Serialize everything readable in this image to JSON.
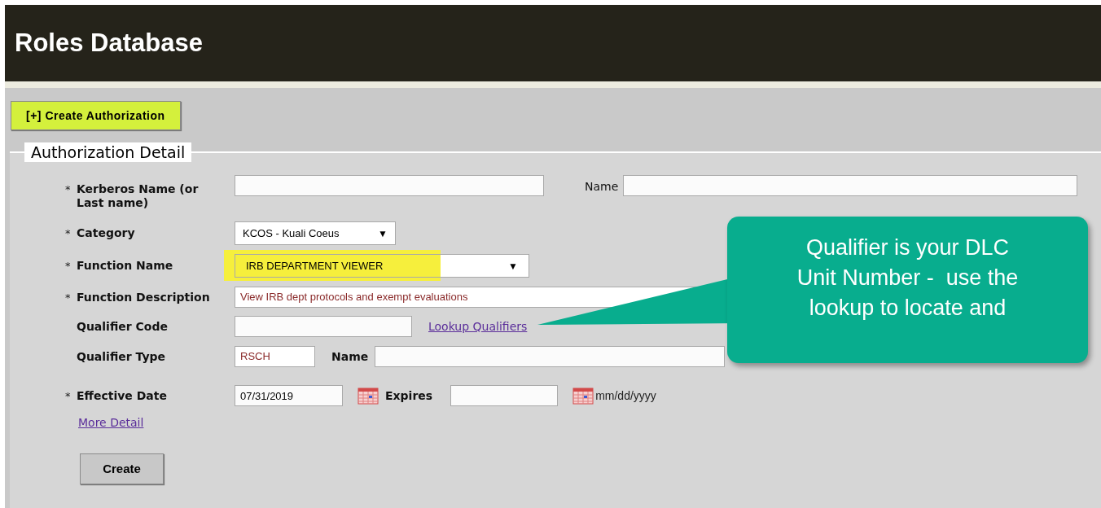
{
  "header": {
    "title": "Roles Database"
  },
  "create_button": "[+] Create Authorization",
  "section": {
    "legend": "Authorization Detail"
  },
  "kerberos": {
    "required_mark": "*",
    "label": "Kerberos Name (or Last name)",
    "name_label": "Name"
  },
  "category": {
    "required_mark": "*",
    "label": "Category",
    "value": "KCOS - Kuali Coeus",
    "arrow": "▼"
  },
  "function_name": {
    "required_mark": "*",
    "label": "Function Name",
    "value": "IRB DEPARTMENT VIEWER",
    "arrow": "▼",
    "highlighted": true
  },
  "function_description": {
    "required_mark": "*",
    "label": "Function Description",
    "value": "View IRB dept protocols and exempt evaluations"
  },
  "qualifier_code": {
    "label": "Qualifier Code",
    "link": "Lookup Qualifiers"
  },
  "qualifier_type": {
    "label": "Qualifier Type",
    "value": "RSCH",
    "name_label": "Name"
  },
  "effective_date": {
    "required_mark": "*",
    "label": "Effective Date",
    "value": "07/31/2019",
    "expires_label": "Expires",
    "format_hint": "mm/dd/yyyy"
  },
  "more_detail_link": "More Detail",
  "submit_button": "Create",
  "callout": {
    "lines": [
      "Qualifier is your DLC",
      "Unit Number -  use the",
      "lookup to locate and"
    ]
  }
}
